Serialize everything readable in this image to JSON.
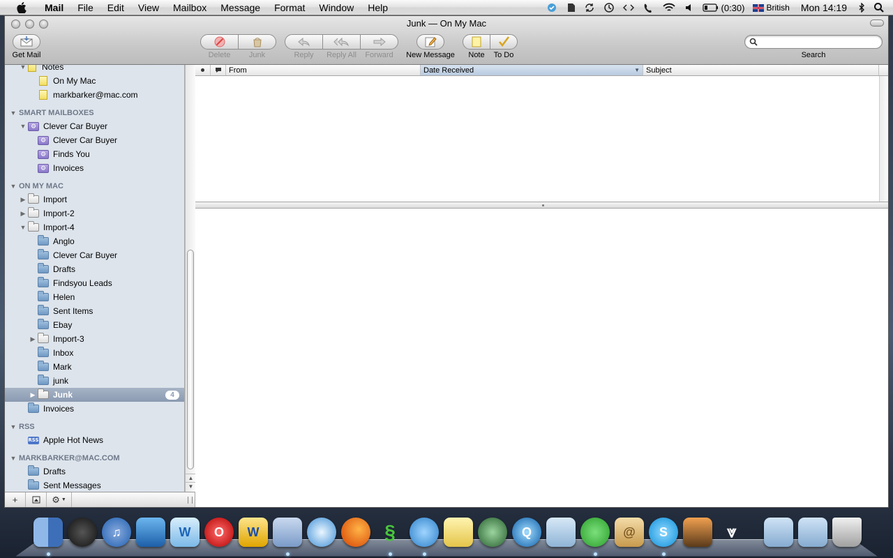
{
  "menubar": {
    "app": "Mail",
    "items": [
      "File",
      "Edit",
      "View",
      "Mailbox",
      "Message",
      "Format",
      "Window",
      "Help"
    ],
    "battery": "(0:30)",
    "input_source": "British",
    "clock": "Mon 14:19"
  },
  "window": {
    "title": "Junk — On My Mac"
  },
  "toolbar": {
    "get_mail": "Get Mail",
    "delete": "Delete",
    "junk": "Junk",
    "reply": "Reply",
    "reply_all": "Reply All",
    "forward": "Forward",
    "new_message": "New Message",
    "note": "Note",
    "to_do": "To Do",
    "search_label": "Search",
    "search_value": ""
  },
  "sidebar": {
    "notes_root": "Notes",
    "notes": [
      "On My Mac",
      "markbarker@mac.com"
    ],
    "smart_header": "SMART MAILBOXES",
    "smart_parent": "Clever Car Buyer",
    "smart_children": [
      "Clever Car Buyer",
      "Finds You",
      "Invoices"
    ],
    "onmac_header": "ON MY MAC",
    "import": "Import",
    "import2": "Import-2",
    "import4": "Import-4",
    "import4_children": [
      "Anglo",
      "Clever Car Buyer",
      "Drafts",
      "Findsyou Leads",
      "Helen",
      "Sent Items",
      "Ebay",
      "Import-3",
      "Inbox",
      "Mark",
      "junk"
    ],
    "junk_selected": "Junk",
    "junk_count": "4",
    "invoices": "Invoices",
    "rss_header": "RSS",
    "rss_icon_text": "RSS",
    "rss_item": "Apple Hot News",
    "account_header": "MARKBARKER@MAC.COM",
    "account_items": [
      "Drafts",
      "Sent Messages"
    ]
  },
  "message_list": {
    "columns": [
      "From",
      "Date Received",
      "Subject"
    ],
    "sorted_column": "Date Received"
  },
  "colors": {
    "sidebar_bg": "#dde4ec",
    "selection": "#8a9ab1",
    "header_text": "#6e7889"
  },
  "dock": {
    "apps": [
      "finder-icon",
      "dashboard-icon",
      "itunes-icon",
      "imovie-icon",
      "iweb-icon",
      "opera-icon",
      "word-icon",
      "mail-stamp-icon",
      "safari-icon",
      "firefox-icon",
      "msn-icon",
      "messenger-icon",
      "notes-icon",
      "time-machine-icon",
      "quicktime-icon",
      "iphoto-icon",
      "spotify-icon",
      "address-book-icon",
      "skype-icon",
      "photo-booth-icon",
      "vuze-icon",
      "applications-folder-icon",
      "documents-folder-icon",
      "trash-icon"
    ]
  }
}
